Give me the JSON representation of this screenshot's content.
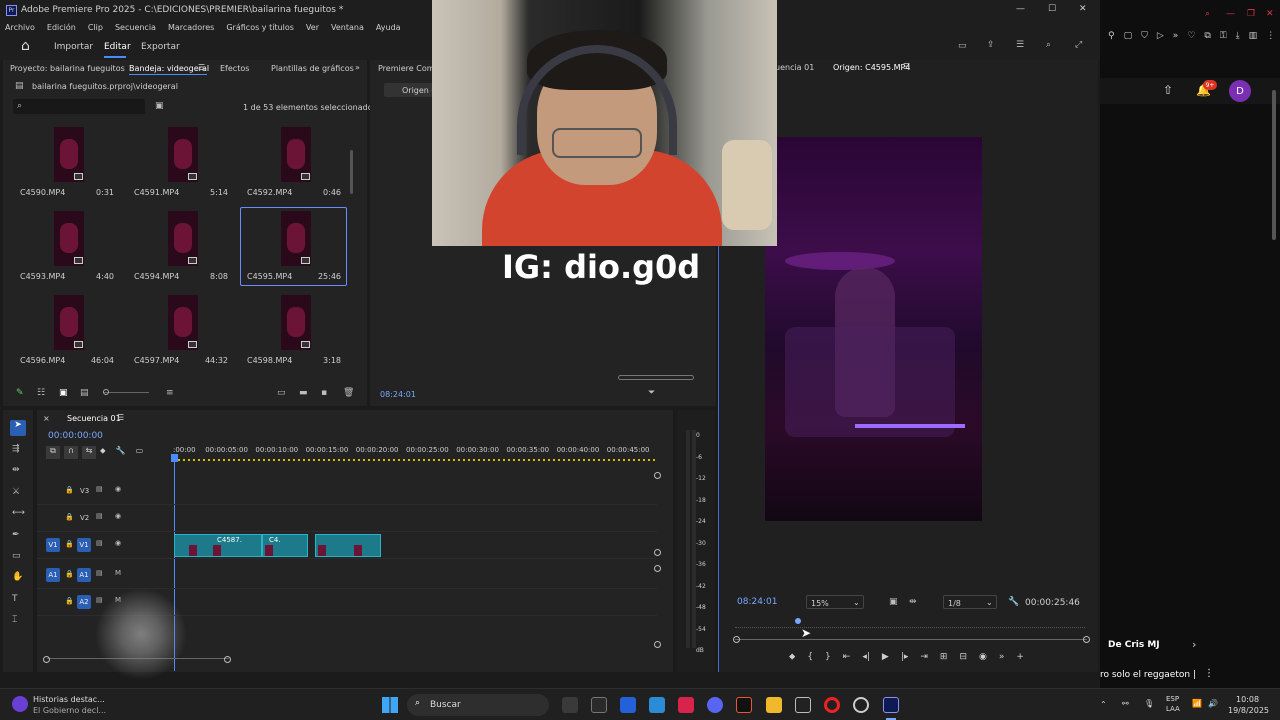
{
  "titlebar": {
    "title": "Adobe Premiere Pro 2025 - C:\\EDICIONES\\PREMIER\\bailarina fueguitos *"
  },
  "menu": [
    "Archivo",
    "Edición",
    "Clip",
    "Secuencia",
    "Marcadores",
    "Gráficos y títulos",
    "Ver",
    "Ventana",
    "Ayuda"
  ],
  "workspace": {
    "home": "⌂",
    "importar": "Importar",
    "editar": "Editar",
    "exportar": "Exportar"
  },
  "leftpanel": {
    "tabs": [
      "Proyecto: bailarina fueguitos",
      "Bandeja: videogeral",
      "Efectos",
      "Plantillas de gráficos"
    ],
    "path": "bailarina fueguitos.prproj\\videogeral",
    "selection": "1 de 53 elementos seleccionados",
    "items": [
      {
        "name": "C4590.MP4",
        "dur": "0:31"
      },
      {
        "name": "C4591.MP4",
        "dur": "5:14"
      },
      {
        "name": "C4592.MP4",
        "dur": "0:46"
      },
      {
        "name": "C4593.MP4",
        "dur": "4:40"
      },
      {
        "name": "C4594.MP4",
        "dur": "8:08"
      },
      {
        "name": "C4595.MP4",
        "dur": "25:46"
      },
      {
        "name": "C4596.MP4",
        "dur": "46:04"
      },
      {
        "name": "C4597.MP4",
        "dur": "44:32"
      },
      {
        "name": "C4598.MP4",
        "dur": "3:18"
      }
    ]
  },
  "midpanel": {
    "tab": "Premiere Compo",
    "origen": "Origen -",
    "timecode": "08:24:01"
  },
  "overlay": {
    "ig": "IG: dio.g0d"
  },
  "rightpanel": {
    "tab1": "uencia 01",
    "tab2": "Origen: C4595.MP4",
    "timecode": "08:24:01",
    "zoom": "15%",
    "res": "1/8",
    "duration": "00:00:25:46"
  },
  "timeline": {
    "tab": "Secuencia 01",
    "timecode": "00:00:00:00",
    "ruler": [
      ":00:00",
      "00:00:05:00",
      "00:00:10:00",
      "00:00:15:00",
      "00:00:20:00",
      "00:00:25:00",
      "00:00:30:00",
      "00:00:35:00",
      "00:00:40:00",
      "00:00:45:00"
    ],
    "tracks": [
      "V3",
      "V2",
      "V1",
      "A1",
      "A2"
    ],
    "clips": [
      "C4587.",
      "C4."
    ],
    "meter": [
      "0",
      "-6",
      "-12",
      "-18",
      "-24",
      "-30",
      "-36",
      "-42",
      "-48",
      "-54",
      "dB"
    ]
  },
  "sidepanel": {
    "badge": "9+",
    "avatar": "D",
    "chat1": "De Cris MJ",
    "chat2": "ro solo el reggaeton |"
  },
  "taskbar": {
    "news1": "Historias destac...",
    "news2": "El Gobierno decl...",
    "search": "Buscar",
    "lang1": "ESP",
    "lang2": "LAA",
    "time": "10:08",
    "date": "19/8/2025"
  },
  "colors": {
    "accent": "#2b5fb3",
    "clip": "#1c7a8a",
    "ruler_yellow": "#d8c000"
  }
}
